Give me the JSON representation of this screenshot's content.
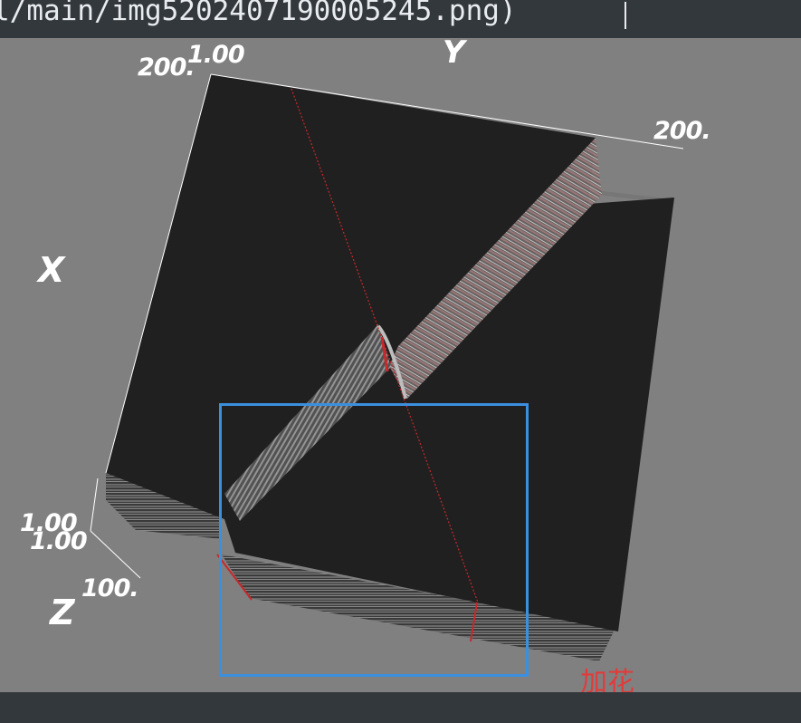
{
  "window": {
    "title_text": "l/main/img520240719000524​5.png)"
  },
  "axes": {
    "x_label": "X",
    "y_label": "Y",
    "z_label": "Z",
    "y_start": "1.00",
    "y_end": "200.",
    "x_start_top": "200.",
    "x_end": "1.00",
    "z_start": "1.00",
    "z_end": "100."
  },
  "annotation": {
    "text": "加花"
  },
  "colors": {
    "background": "#808080",
    "chrome": "#33383d",
    "volume_face": "#202020",
    "selection": "#3b8fde",
    "trace": "#c8282b"
  }
}
